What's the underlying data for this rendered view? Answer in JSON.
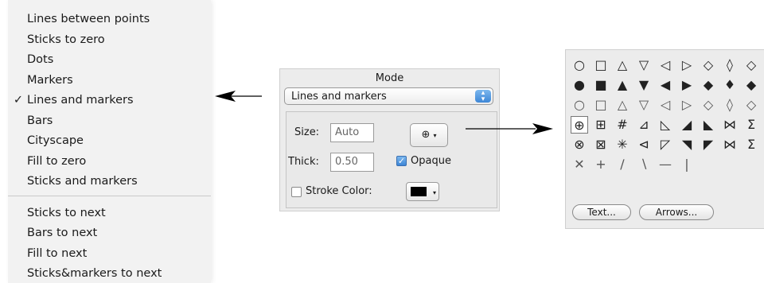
{
  "menu": {
    "items": [
      {
        "label": "Lines between points",
        "checked": false
      },
      {
        "label": "Sticks to zero",
        "checked": false
      },
      {
        "label": "Dots",
        "checked": false
      },
      {
        "label": "Markers",
        "checked": false
      },
      {
        "label": "Lines and markers",
        "checked": true
      },
      {
        "label": "Bars",
        "checked": false
      },
      {
        "label": "Cityscape",
        "checked": false
      },
      {
        "label": "Fill to zero",
        "checked": false
      },
      {
        "label": "Sticks and markers",
        "checked": false
      },
      {
        "label": "Sticks to next",
        "checked": false
      },
      {
        "label": "Bars to next",
        "checked": false
      },
      {
        "label": "Fill to next",
        "checked": false
      },
      {
        "label": "Sticks&markers to next",
        "checked": false
      }
    ],
    "check_glyph": "✓"
  },
  "panel": {
    "mode_title": "Mode",
    "mode_value": "Lines and markers",
    "size_label": "Size:",
    "size_value": "Auto",
    "thick_label": "Thick:",
    "thick_value": "0.50",
    "marker_button_glyph": "⊕",
    "opaque_label": "Opaque",
    "opaque_checked": true,
    "stroke_label": "Stroke Color:",
    "stroke_checked": false,
    "stroke_color": "#000000"
  },
  "palette": {
    "rows": [
      [
        "○",
        "□",
        "△",
        "▽",
        "◁",
        "▷",
        "◇",
        "◊",
        "◇"
      ],
      [
        "●",
        "■",
        "▲",
        "▼",
        "◀",
        "▶",
        "◆",
        "♦",
        "◆"
      ],
      [
        "○",
        "□",
        "△",
        "▽",
        "◁",
        "▷",
        "◇",
        "◊",
        "◇"
      ],
      [
        "⊕",
        "⊞",
        "#",
        "⊿",
        "◺",
        "◢",
        "◣",
        "⋈",
        "Σ"
      ],
      [
        "⊗",
        "⊠",
        "✳",
        "⊲",
        "◸",
        "◥",
        "◤",
        "⋈",
        "Σ"
      ],
      [
        "✕",
        "+",
        "∕",
        "∖",
        "—",
        "|"
      ]
    ],
    "selected": [
      3,
      0
    ],
    "text_button": "Text...",
    "arrows_button": "Arrows..."
  },
  "colors": {
    "accent": "#3d86d6",
    "menu_bg": "#f2f2f2",
    "panel_bg": "#ececec"
  }
}
